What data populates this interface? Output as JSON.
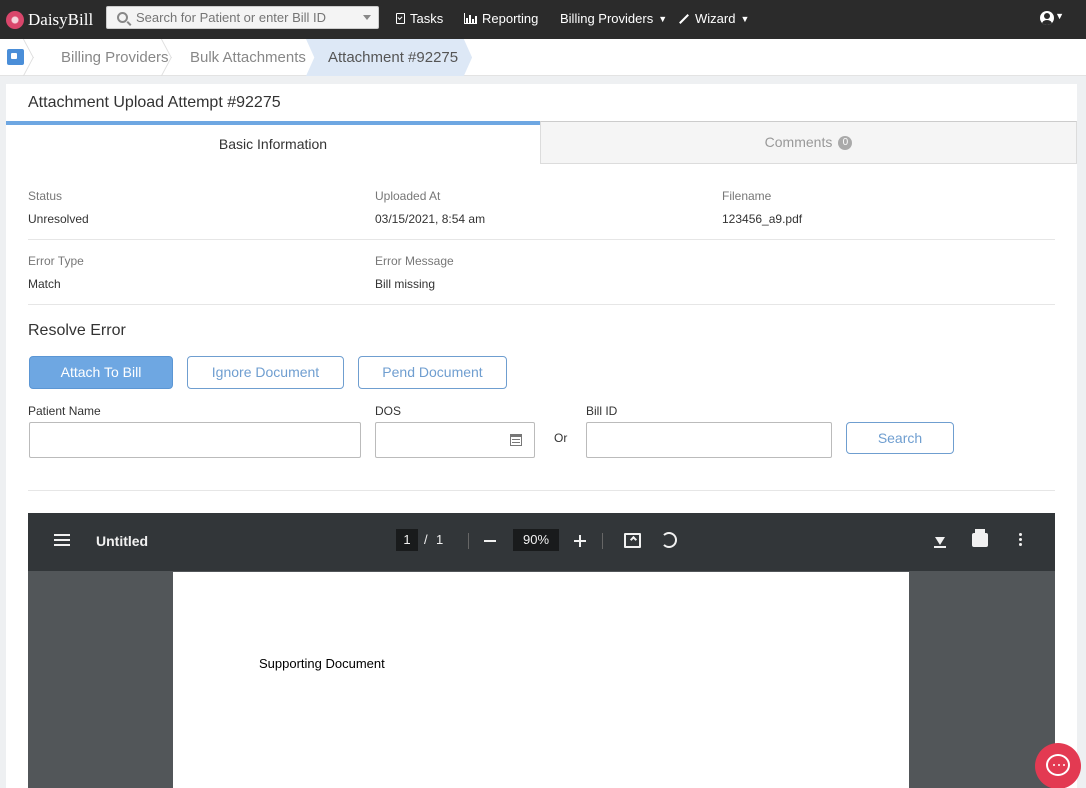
{
  "app": {
    "name": "DaisyBill"
  },
  "nav": {
    "search_placeholder": "Search for Patient or enter Bill ID",
    "tasks": "Tasks",
    "reporting": "Reporting",
    "billing_providers": "Billing Providers",
    "wizard": "Wizard"
  },
  "breadcrumb": [
    "Billing Providers",
    "Bulk Attachments",
    "Attachment #92275"
  ],
  "page": {
    "title": "Attachment Upload Attempt #92275",
    "tabs": {
      "basic": "Basic Information",
      "comments": "Comments",
      "comments_count": "0"
    }
  },
  "info": {
    "status_label": "Status",
    "status_value": "Unresolved",
    "uploaded_label": "Uploaded At",
    "uploaded_value": "03/15/2021, 8:54 am",
    "filename_label": "Filename",
    "filename_value": "123456_a9.pdf",
    "error_type_label": "Error Type",
    "error_type_value": "Match",
    "error_message_label": "Error Message",
    "error_message_value": "Bill missing"
  },
  "resolve": {
    "title": "Resolve Error",
    "attach_button": "Attach To Bill",
    "ignore_button": "Ignore Document",
    "pend_button": "Pend Document",
    "patient_name_label": "Patient Name",
    "dos_label": "DOS",
    "or_label": "Or",
    "bill_id_label": "Bill ID",
    "search_button": "Search"
  },
  "pdf": {
    "title": "Untitled",
    "page": "1",
    "slash": "/",
    "total": "1",
    "zoom": "90%",
    "doc_text": "Supporting Document"
  },
  "colors": {
    "accent": "#6ea7e2",
    "nav_bg": "#2b2b2b",
    "chat": "#e33a52"
  }
}
